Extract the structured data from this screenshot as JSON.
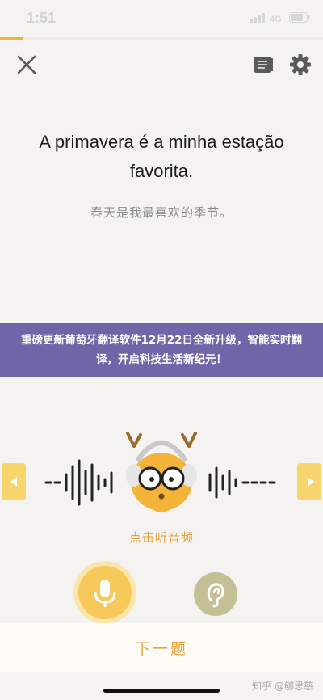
{
  "status_bar": {
    "time": "1:51"
  },
  "progress": {
    "fraction": 0.07
  },
  "toolbar": {
    "close": "close-icon",
    "notebook": "notebook-icon",
    "settings": "gear-icon"
  },
  "lesson": {
    "sentence": "A primavera é a minha estação favorita.",
    "translation": "春天是我最喜欢的季节。"
  },
  "banner": {
    "text": "重磅更新葡萄牙翻译软件12月22日全新升级，智能实时翻译，开启科技生活新纪元！"
  },
  "audio": {
    "tap_label": "点击听音频"
  },
  "footer": {
    "next_label": "下一题"
  },
  "watermark": {
    "text": "知乎 @郇思慈"
  },
  "colors": {
    "accent": "#f4b43a",
    "banner": "#6f65a8",
    "label": "#e9a33a"
  }
}
